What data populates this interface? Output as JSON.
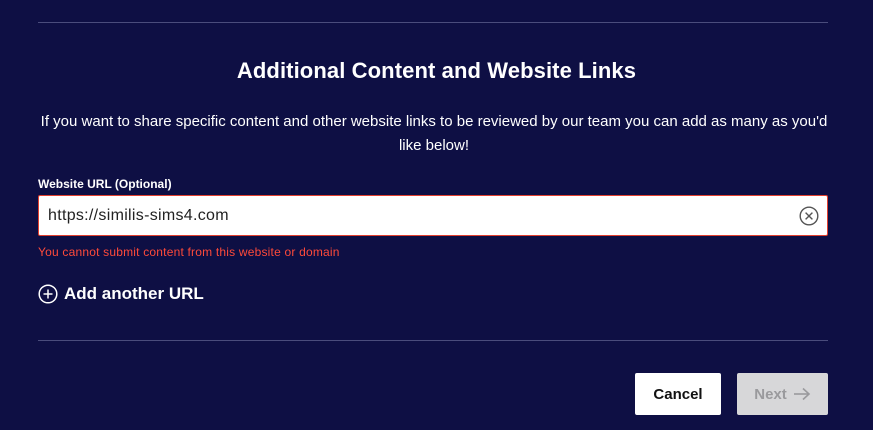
{
  "section": {
    "title": "Additional Content and Website Links",
    "description": "If you want to share specific content and other website links to be reviewed by our team you can add as many as you'd like below!"
  },
  "url_field": {
    "label": "Website URL (Optional)",
    "value": "https://similis-sims4.com",
    "error": "You cannot submit content from this website or domain",
    "clear_icon": "close-circle-icon"
  },
  "add_url": {
    "label": "Add another URL",
    "icon": "plus-circle-icon"
  },
  "actions": {
    "cancel_label": "Cancel",
    "next_label": "Next",
    "next_icon": "arrow-right-icon"
  },
  "colors": {
    "background": "#0e0f44",
    "error": "#ff4a3a",
    "input_border_error": "#e2402f",
    "disabled_button": "#d7d7d9"
  }
}
